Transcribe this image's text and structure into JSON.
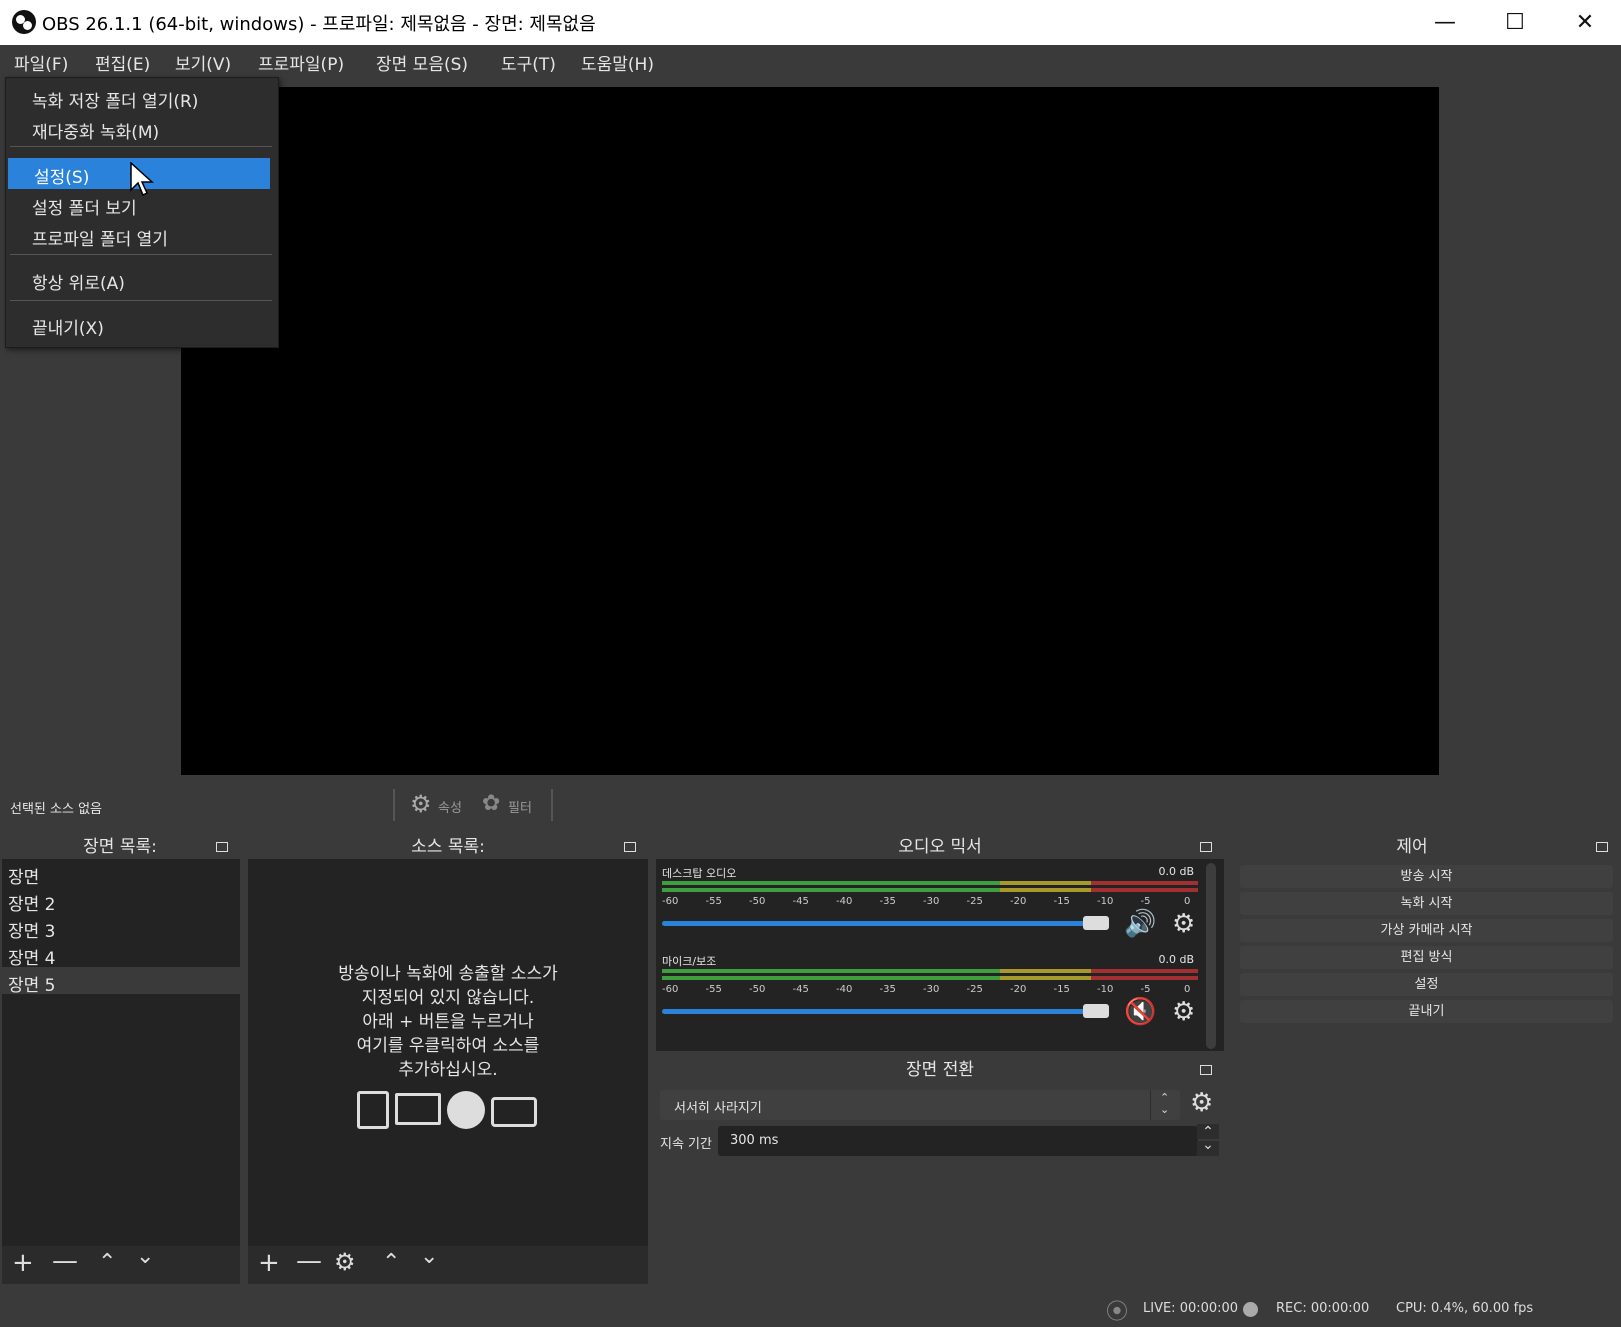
{
  "window": {
    "title": "OBS 26.1.1 (64-bit, windows) - 프로파일: 제목없음 - 장면: 제목없음"
  },
  "menubar": [
    "파일(F)",
    "편집(E)",
    "보기(V)",
    "프로파일(P)",
    "장면 모음(S)",
    "도구(T)",
    "도움말(H)"
  ],
  "file_menu": {
    "items": [
      "녹화 저장 폴더 열기(R)",
      "재다중화 녹화(M)",
      "설정(S)",
      "설정 폴더 보기",
      "프로파일 폴더 열기",
      "항상 위로(A)",
      "끝내기(X)"
    ],
    "selected": "설정(S)"
  },
  "source_toolbar": {
    "no_source": "선택된 소스 없음",
    "properties": "속성",
    "filters": "필터"
  },
  "scenes": {
    "title": "장면 목록:",
    "items": [
      "장면",
      "장면 2",
      "장면 3",
      "장면 4",
      "장면 5"
    ],
    "selected": "장면 5"
  },
  "sources": {
    "title": "소스 목록:",
    "empty_lines": [
      "방송이나 녹화에 송출할 소스가",
      "지정되어 있지 않습니다.",
      "아래 + 버튼을 누르거나",
      "여기를 우클릭하여 소스를",
      "추가하십시오."
    ]
  },
  "mixer": {
    "title": "오디오 믹서",
    "ticks": [
      "-60",
      "-55",
      "-50",
      "-45",
      "-40",
      "-35",
      "-30",
      "-25",
      "-20",
      "-15",
      "-10",
      "-5",
      "0"
    ],
    "channels": [
      {
        "name": "데스크탑 오디오",
        "db": "0.0 dB",
        "volume": 0.94,
        "muted": false
      },
      {
        "name": "마이크/보조",
        "db": "0.0 dB",
        "volume": 0.94,
        "muted": true
      }
    ]
  },
  "transitions": {
    "title": "장면 전환",
    "selected": "서서히 사라지기",
    "duration_label": "지속 기간",
    "duration": "300 ms"
  },
  "controls": {
    "title": "제어",
    "buttons": [
      "방송 시작",
      "녹화 시작",
      "가상 카메라 시작",
      "편집 방식",
      "설정",
      "끝내기"
    ]
  },
  "status": {
    "live": "LIVE: 00:00:00",
    "rec": "REC: 00:00:00",
    "cpu": "CPU: 0.4%, 60.00 fps"
  },
  "colors": {
    "accent": "#2a82da",
    "panel": "#3a3a3a",
    "dark": "#232323"
  }
}
